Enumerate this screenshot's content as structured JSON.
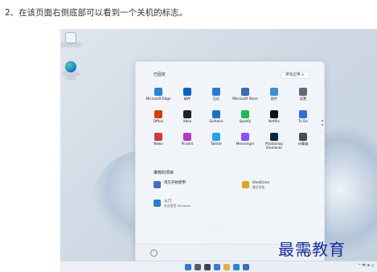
{
  "caption": "2、在该页面右侧底部可以看到一个关机的标志。",
  "desktop": {
    "icons": [
      {
        "label": "Recycle Bin",
        "icon": "recycle-bin-icon"
      },
      {
        "label": "Microsoft Edge",
        "icon": "edge-icon"
      }
    ]
  },
  "start_menu": {
    "pinned_title": "已固定",
    "all_apps_label": "所有应用  >",
    "pinned": [
      {
        "label": "Microsoft Edge",
        "icon": "edge-icon",
        "color": "#1e88d8"
      },
      {
        "label": "邮件",
        "icon": "mail-icon",
        "color": "#0a64c8"
      },
      {
        "label": "日历",
        "icon": "calendar-icon",
        "color": "#2b79d6"
      },
      {
        "label": "Microsoft Store",
        "icon": "store-icon",
        "color": "#3a6fb0"
      },
      {
        "label": "照片",
        "icon": "photos-icon",
        "color": "#3a8fd8"
      },
      {
        "label": "设置",
        "icon": "settings-gear-icon",
        "color": "#5b6b7c"
      },
      {
        "label": "Office",
        "icon": "office-icon",
        "color": "#d83b01"
      },
      {
        "label": "Xbox",
        "icon": "xbox-icon",
        "color": "#222222"
      },
      {
        "label": "Solitaire",
        "icon": "solitaire-icon",
        "color": "#1a73c8"
      },
      {
        "label": "Spotify",
        "icon": "spotify-icon",
        "color": "#1db954"
      },
      {
        "label": "Netflix",
        "icon": "netflix-icon",
        "color": "#111111"
      },
      {
        "label": "To Do",
        "icon": "todo-icon",
        "color": "#2f6fd8"
      },
      {
        "label": "News",
        "icon": "news-icon",
        "color": "#d03a3a"
      },
      {
        "label": "PicsArt",
        "icon": "picsart-icon",
        "color": "#b23cc8"
      },
      {
        "label": "Twitter",
        "icon": "twitter-icon",
        "color": "#1da1f2"
      },
      {
        "label": "Messenger",
        "icon": "messenger-icon",
        "color": "#8a4fff"
      },
      {
        "label": "Photoshop Elements",
        "icon": "photoshop-icon",
        "color": "#0b2a4a"
      },
      {
        "label": "计算器",
        "icon": "calculator-icon",
        "color": "#454d57"
      }
    ],
    "recommended_title": "推荐的项目",
    "recommended": [
      {
        "title": "现在开始使用",
        "subtitle": "",
        "icon": "get-started-icon",
        "color": "#3b6fbf"
      },
      {
        "title": "OneDrive",
        "subtitle": "最近添加",
        "icon": "onedrive-icon",
        "color": "#e0a12b"
      },
      {
        "title": "入门",
        "subtitle": "欢迎使用 Windows",
        "icon": "tips-icon",
        "color": "#2a7bd4"
      }
    ]
  },
  "taskbar": {
    "tray_text": "^ 中 ⊕ ◁",
    "icons": [
      "start-icon",
      "search-icon",
      "task-view-icon",
      "widgets-icon",
      "file-explorer-icon",
      "edge-icon",
      "store-icon"
    ]
  },
  "watermark": "最需教育"
}
